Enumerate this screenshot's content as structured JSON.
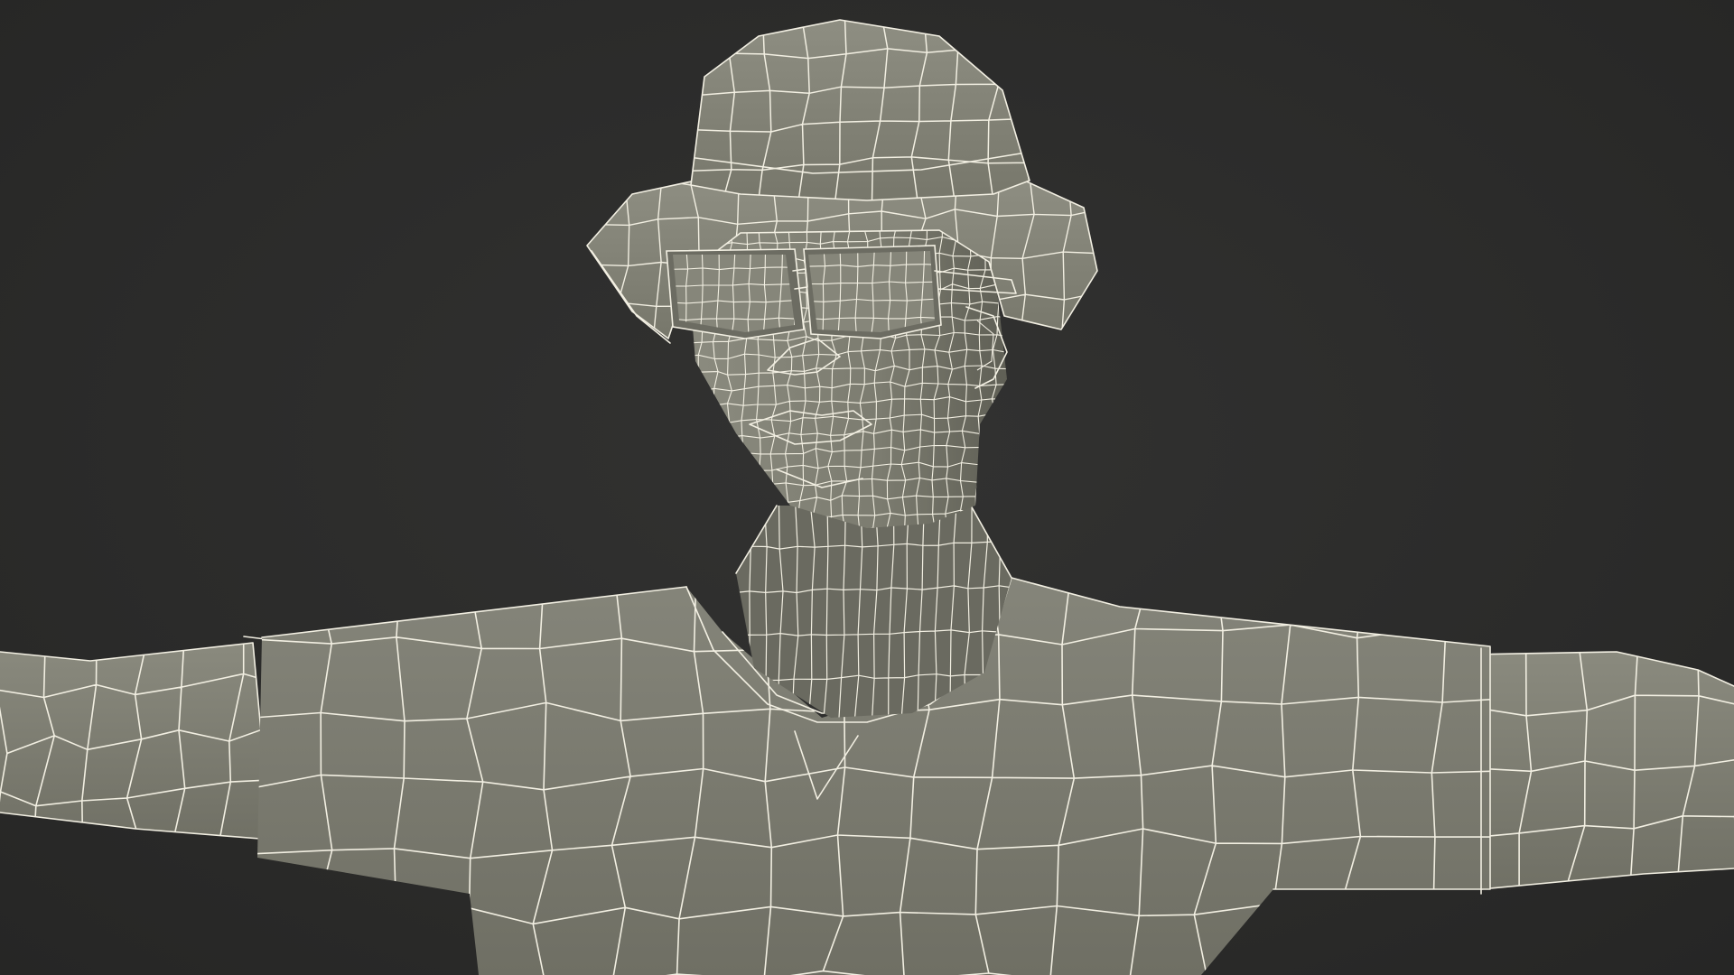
{
  "scene": {
    "subject": "wireframe-human-bust",
    "background_color": "#2c2c2b",
    "mesh_color": "#7a7a6e",
    "wire_color": "#f2efe2"
  }
}
